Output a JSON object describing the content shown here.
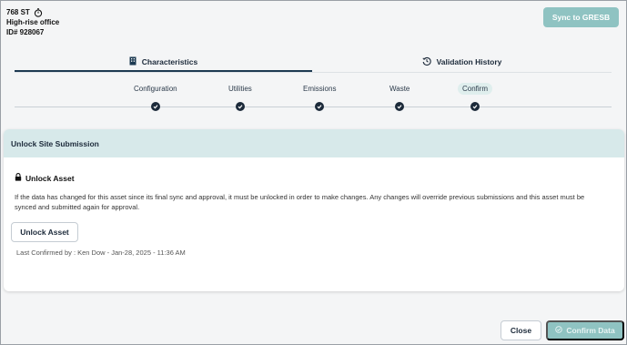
{
  "header": {
    "asset_number": "768 ST",
    "asset_type": "High-rise office",
    "asset_id": "ID# 928067",
    "sync_button": "Sync to GRESB"
  },
  "tabs": [
    {
      "label": "Characteristics",
      "icon": "building-icon",
      "active": true
    },
    {
      "label": "Validation History",
      "icon": "history-icon",
      "active": false
    }
  ],
  "steps": [
    {
      "label": "Configuration",
      "complete": true,
      "active": false
    },
    {
      "label": "Utilities",
      "complete": true,
      "active": false
    },
    {
      "label": "Emissions",
      "complete": true,
      "active": false
    },
    {
      "label": "Waste",
      "complete": true,
      "active": false
    },
    {
      "label": "Confirm",
      "complete": true,
      "active": true
    }
  ],
  "panel": {
    "title": "Unlock Site Submission",
    "unlock_heading": "Unlock Asset",
    "description": "If the data has changed for this asset since its final sync and approval, it must be unlocked in order to make changes. Any changes will override previous submissions and this asset must be synced and submitted again for approval.",
    "unlock_button": "Unlock Asset",
    "last_confirmed": "Last Confirmed by : Ken Dow - Jan-28, 2025 - 11:36 AM"
  },
  "footer": {
    "close_button": "Close",
    "confirm_button": "Confirm Data"
  },
  "colors": {
    "accent": "#8fc3c2",
    "primary": "#1d3a52",
    "panel_header": "#d7e9ea"
  }
}
